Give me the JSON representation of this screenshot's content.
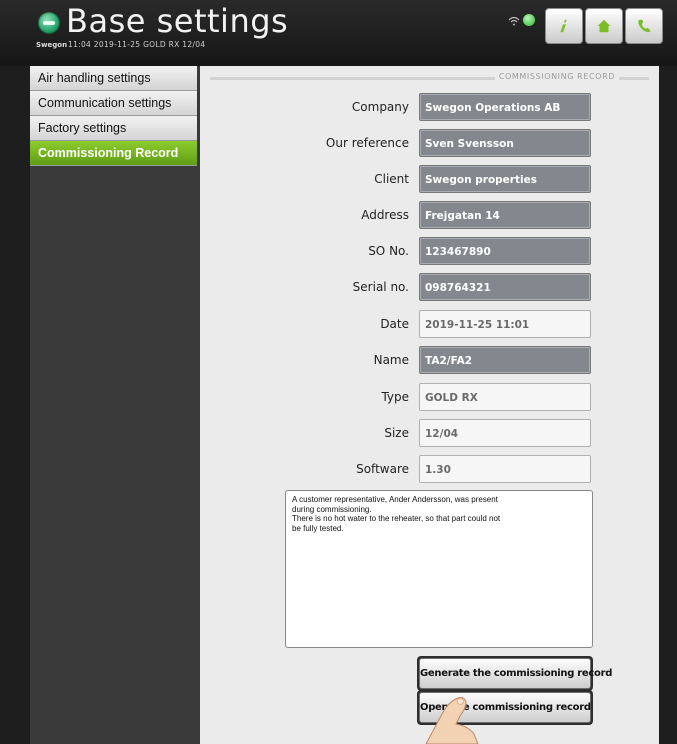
{
  "header": {
    "title": "Base settings",
    "brand": "Swegon",
    "status": "11:04  2019-11-25  GOLD RX 12/04",
    "wifi_label": "wifi",
    "buttons": [
      "info-button",
      "home-button",
      "phone-button"
    ]
  },
  "sidebar": {
    "items": [
      {
        "label": "Air handling settings",
        "active": false
      },
      {
        "label": "Communication settings",
        "active": false
      },
      {
        "label": "Factory settings",
        "active": false
      },
      {
        "label": "Commissioning Record",
        "active": true
      }
    ]
  },
  "main": {
    "section_title": "COMMISSIONING RECORD",
    "fields": [
      {
        "label": "Company",
        "value": "Swegon Operations AB",
        "editable": true
      },
      {
        "label": "Our reference",
        "value": "Sven Svensson",
        "editable": true
      },
      {
        "label": "Client",
        "value": "Swegon properties",
        "editable": true
      },
      {
        "label": "Address",
        "value": "Frejgatan 14",
        "editable": true
      },
      {
        "label": "SO No.",
        "value": "123467890",
        "editable": true
      },
      {
        "label": "Serial no.",
        "value": "098764321",
        "editable": true
      },
      {
        "label": "Date",
        "value": "2019-11-25 11:01",
        "editable": false
      },
      {
        "label": "Name",
        "value": "TA2/FA2",
        "editable": true
      },
      {
        "label": "Type",
        "value": "GOLD RX",
        "editable": false
      },
      {
        "label": "Size",
        "value": "12/04",
        "editable": false
      },
      {
        "label": "Software",
        "value": "1.30",
        "editable": false
      }
    ],
    "notes": "A customer representative, Ander Andersson, was present\nduring commissioning.\nThere is no hot water to the reheater, so that part could not\nbe fully tested.",
    "generate_label": "Generate the commissioning record",
    "open_label": "Open the commissioning record"
  },
  "colors": {
    "accent_green": "#7cbc24",
    "editable_field": "#84888e",
    "background": "#1e1e1e"
  }
}
